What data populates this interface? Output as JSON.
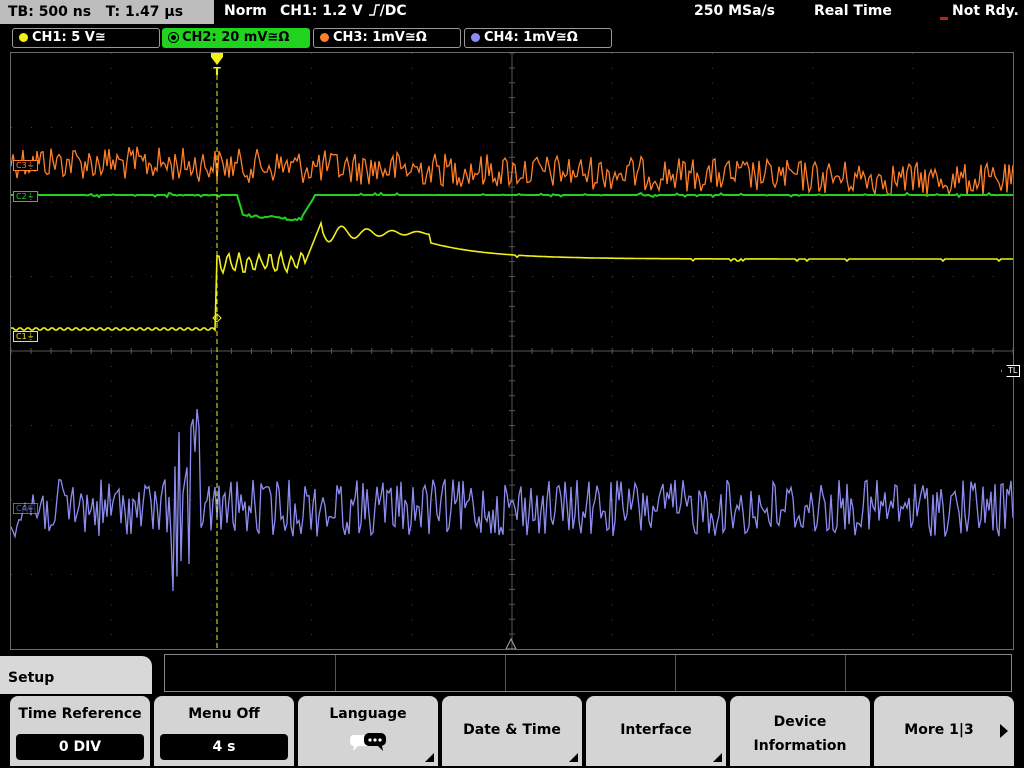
{
  "topbar": {
    "timebase": "TB: 500 ns",
    "trigger_time": "T: 1.47 µs",
    "mode": "Norm",
    "trigger_level": "CH1: 1.2 V",
    "trigger_coupling": "DC",
    "sample_rate": "250 MSa/s",
    "acquisition": "Real Time",
    "status": "Not Rdy."
  },
  "channels": [
    {
      "label": "CH1: 5 V",
      "suffix": "≅",
      "color": "#f0f018",
      "active": false
    },
    {
      "label": "CH2: 20 mV",
      "suffix": "≅Ω",
      "color": "#20d020",
      "active": true
    },
    {
      "label": "CH3: 1mV",
      "suffix": "≅Ω",
      "color": "#ff7f2a",
      "active": false
    },
    {
      "label": "CH4: 1mV",
      "suffix": "≅Ω",
      "color": "#8c8cf0",
      "active": false
    }
  ],
  "markers": {
    "c1": "C1",
    "c2": "C2",
    "c3": "C3",
    "c4": "C4",
    "trigger": "T",
    "trigger_level": "TL"
  },
  "menu": {
    "title": "Setup",
    "time_reference_label": "Time Reference",
    "time_reference_value": "0 DIV",
    "menu_off_label": "Menu Off",
    "menu_off_value": "4 s",
    "language_label": "Language",
    "date_time_label": "Date & Time",
    "interface_label": "Interface",
    "device_info_line1": "Device",
    "device_info_line2": "Information",
    "more_label": "More 1|3"
  },
  "colors": {
    "ch1": "#f0f018",
    "ch2": "#20d020",
    "ch3": "#ff7f2a",
    "ch4": "#8c8cf0",
    "grid": "#5a5a5a"
  }
}
